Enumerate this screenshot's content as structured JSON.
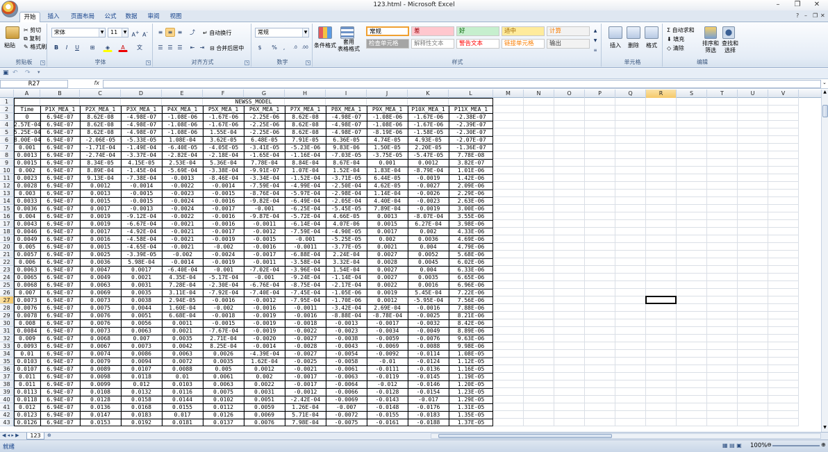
{
  "window": {
    "title": "123.html - Microsoft Excel"
  },
  "ribbon_tabs": [
    "开始",
    "插入",
    "页面布局",
    "公式",
    "数据",
    "审阅",
    "视图"
  ],
  "clipboard": {
    "paste": "粘贴",
    "cut": "剪切",
    "copy": "复制",
    "format_painter": "格式刷",
    "label": "剪贴板"
  },
  "font": {
    "name": "宋体",
    "size": "11",
    "label": "字体",
    "bold": "B",
    "italic": "I",
    "underline": "U"
  },
  "alignment": {
    "wrap": "自动换行",
    "merge": "合并后居中",
    "label": "对齐方式"
  },
  "number": {
    "format": "常规",
    "percent": "%",
    "comma": ",",
    "label": "数字"
  },
  "styles": {
    "conditional": "条件格式",
    "table_format": "套用\n表格格式",
    "cells": [
      {
        "text": "常规",
        "bg": "#ffffff",
        "fg": "#000000"
      },
      {
        "text": "差",
        "bg": "#ffc7ce",
        "fg": "#9c0006"
      },
      {
        "text": "好",
        "bg": "#c6efce",
        "fg": "#006100"
      },
      {
        "text": "适中",
        "bg": "#ffeb9c",
        "fg": "#9c6500"
      },
      {
        "text": "计算",
        "bg": "#f2f2f2",
        "fg": "#fa7d00"
      },
      {
        "text": "检查单元格",
        "bg": "#a5a5a5",
        "fg": "#ffffff"
      },
      {
        "text": "解释性文本",
        "bg": "#ffffff",
        "fg": "#7f7f7f"
      },
      {
        "text": "警告文本",
        "bg": "#ffffff",
        "fg": "#ff0000"
      },
      {
        "text": "链接单元格",
        "bg": "#ffffff",
        "fg": "#fa7d00"
      },
      {
        "text": "输出",
        "bg": "#f2f2f2",
        "fg": "#3f3f3f"
      }
    ],
    "label": "样式"
  },
  "cells_group": {
    "insert": "插入",
    "delete": "删除",
    "format": "格式",
    "label": "单元格"
  },
  "editing": {
    "autosum": "自动求和",
    "fill": "填充",
    "clear": "清除",
    "sort": "排序和\n筛选",
    "find": "查找和\n选择",
    "label": "编辑"
  },
  "name_box": "R27",
  "formula_fx": "fx",
  "columns": [
    "A",
    "B",
    "C",
    "D",
    "E",
    "F",
    "G",
    "H",
    "I",
    "J",
    "K",
    "L",
    "M",
    "N",
    "O",
    "P",
    "Q",
    "R",
    "S",
    "T",
    "U",
    "V"
  ],
  "selected_column": "R",
  "selected_row": "27",
  "sheet": {
    "title": "NEWSS_MODEL",
    "headers": [
      "Time",
      "P1X_MEA_1",
      "P2X_MEA_1",
      "P3X_MEA_1",
      "P4X_MEA_1",
      "P5X_MEA_1",
      "P6X_MEA_1",
      "P7X_MEA_1",
      "P8X_MEA_1",
      "P9X_MEA_1",
      "P10X_MEA_1",
      "P11X_MEA_1"
    ],
    "rows": [
      [
        "0",
        "6.94E-07",
        "8.62E-08",
        "-4.98E-07",
        "-1.08E-06",
        "-1.67E-06",
        "-2.25E-06",
        "8.62E-08",
        "-4.98E-07",
        "-1.08E-06",
        "-1.67E-06",
        "-2.38E-07"
      ],
      [
        "2.57E-04",
        "6.94E-07",
        "8.62E-08",
        "-4.98E-07",
        "-1.08E-06",
        "-1.67E-06",
        "-2.25E-06",
        "8.62E-08",
        "-4.98E-07",
        "-1.08E-06",
        "-1.67E-06",
        "-2.39E-07"
      ],
      [
        "5.25E-04",
        "6.94E-07",
        "8.62E-08",
        "-4.98E-07",
        "-1.08E-06",
        "1.55E-04",
        "-2.25E-06",
        "8.62E-08",
        "-4.98E-07",
        "-8.19E-06",
        "-1.58E-05",
        "-2.30E-07"
      ],
      [
        "8.00E-04",
        "6.94E-07",
        "-2.06E-05",
        "-5.33E-05",
        "1.08E-04",
        "3.62E-05",
        "6.48E-05",
        "7.91E-05",
        "6.36E-05",
        "4.74E-05",
        "4.93E-05",
        "-2.07E-07"
      ],
      [
        "0.001",
        "6.94E-07",
        "-1.71E-04",
        "-1.49E-04",
        "-6.40E-05",
        "-4.05E-05",
        "-3.41E-05",
        "-5.23E-06",
        "9.83E-06",
        "1.50E-05",
        "2.20E-05",
        "-1.36E-07"
      ],
      [
        "0.0013",
        "6.94E-07",
        "-2.74E-04",
        "-3.37E-04",
        "-2.82E-04",
        "-2.18E-04",
        "-1.65E-04",
        "-1.16E-04",
        "-7.03E-05",
        "-3.75E-05",
        "-5.47E-05",
        "7.78E-08"
      ],
      [
        "0.0015",
        "6.94E-07",
        "8.34E-05",
        "4.15E-05",
        "2.53E-04",
        "5.36E-04",
        "7.78E-04",
        "8.84E-04",
        "8.67E-04",
        "0.001",
        "0.0012",
        "3.82E-07"
      ],
      [
        "0.002",
        "6.94E-07",
        "8.89E-04",
        "-1.45E-04",
        "-5.69E-04",
        "-3.38E-04",
        "-9.91E-07",
        "1.07E-04",
        "1.52E-04",
        "1.83E-04",
        "-8.79E-04",
        "1.01E-06"
      ],
      [
        "0.0023",
        "6.94E-07",
        "9.13E-04",
        "-7.38E-04",
        "-0.0013",
        "-8.46E-04",
        "-3.34E-04",
        "-1.52E-04",
        "-3.71E-05",
        "6.44E-05",
        "-0.0019",
        "1.42E-06"
      ],
      [
        "0.0028",
        "6.94E-07",
        "0.0012",
        "-0.0014",
        "-0.0022",
        "-0.0014",
        "-7.59E-04",
        "-4.99E-04",
        "-2.50E-04",
        "4.62E-05",
        "-0.0027",
        "2.09E-06"
      ],
      [
        "0.003",
        "6.94E-07",
        "0.0013",
        "-0.0015",
        "-0.0023",
        "-0.0015",
        "-8.76E-04",
        "-5.97E-04",
        "-2.98E-04",
        "1.14E-04",
        "-0.0026",
        "2.29E-06"
      ],
      [
        "0.0033",
        "6.94E-07",
        "0.0015",
        "-0.0015",
        "-0.0024",
        "-0.0016",
        "-9.82E-04",
        "-6.49E-04",
        "-2.05E-04",
        "4.40E-04",
        "-0.0023",
        "2.63E-06"
      ],
      [
        "0.0036",
        "6.94E-07",
        "0.0017",
        "-0.0013",
        "-0.0024",
        "-0.0017",
        "-0.001",
        "-6.25E-04",
        "-5.45E-05",
        "7.89E-04",
        "-0.0019",
        "3.00E-06"
      ],
      [
        "0.004",
        "6.94E-07",
        "0.0019",
        "-9.12E-04",
        "-0.0022",
        "-0.0016",
        "-9.87E-04",
        "-5.72E-04",
        "4.66E-05",
        "0.0013",
        "-8.07E-04",
        "3.55E-06"
      ],
      [
        "0.0043",
        "6.94E-07",
        "0.0019",
        "-6.67E-04",
        "-0.0021",
        "-0.0016",
        "-0.0011",
        "-6.14E-04",
        "4.07E-06",
        "0.0015",
        "6.27E-04",
        "3.98E-06"
      ],
      [
        "0.0046",
        "6.94E-07",
        "0.0017",
        "-4.92E-04",
        "-0.0021",
        "-0.0017",
        "-0.0012",
        "-7.59E-04",
        "-4.90E-05",
        "0.0017",
        "0.002",
        "4.33E-06"
      ],
      [
        "0.0049",
        "6.94E-07",
        "0.0016",
        "-4.58E-04",
        "-0.0021",
        "-0.0019",
        "-0.0015",
        "-0.001",
        "-5.25E-05",
        "0.002",
        "0.0036",
        "4.69E-06"
      ],
      [
        "0.005",
        "6.94E-07",
        "0.0015",
        "-4.65E-04",
        "-0.0021",
        "-0.002",
        "-0.0016",
        "-0.0011",
        "-3.77E-05",
        "0.0021",
        "0.004",
        "4.79E-06"
      ],
      [
        "0.0057",
        "6.94E-07",
        "0.0025",
        "-3.39E-05",
        "-0.002",
        "-0.0024",
        "-0.0017",
        "-6.88E-04",
        "2.24E-04",
        "0.0027",
        "0.0052",
        "5.68E-06"
      ],
      [
        "0.006",
        "6.94E-07",
        "0.0036",
        "5.98E-04",
        "-0.0014",
        "-0.0019",
        "-0.0011",
        "-3.58E-04",
        "3.32E-04",
        "0.0028",
        "0.0045",
        "6.02E-06"
      ],
      [
        "0.0063",
        "6.94E-07",
        "0.0047",
        "0.0017",
        "-6.40E-04",
        "-0.001",
        "-7.02E-04",
        "-3.96E-04",
        "1.54E-04",
        "0.0027",
        "0.004",
        "6.33E-06"
      ],
      [
        "0.0065",
        "6.94E-07",
        "0.0049",
        "0.0021",
        "4.35E-04",
        "-5.17E-04",
        "-0.001",
        "-9.24E-04",
        "-1.14E-04",
        "0.0027",
        "0.0035",
        "6.65E-06"
      ],
      [
        "0.0068",
        "6.94E-07",
        "0.0063",
        "0.0031",
        "7.28E-04",
        "-2.30E-04",
        "-6.76E-04",
        "-8.75E-04",
        "-2.17E-04",
        "0.0022",
        "0.0016",
        "6.96E-06"
      ],
      [
        "0.007",
        "6.94E-07",
        "0.0069",
        "0.0035",
        "3.11E-04",
        "-7.92E-04",
        "-7.40E-04",
        "-7.45E-04",
        "-1.05E-06",
        "0.0019",
        "5.45E-04",
        "7.22E-06"
      ],
      [
        "0.0073",
        "6.94E-07",
        "0.0073",
        "0.0038",
        "2.94E-05",
        "-0.0016",
        "-0.0012",
        "-7.95E-04",
        "-1.70E-06",
        "0.0012",
        "-5.95E-04",
        "7.56E-06"
      ],
      [
        "0.0076",
        "6.94E-07",
        "0.0075",
        "0.0044",
        "1.60E-04",
        "-0.002",
        "-0.0016",
        "-0.0011",
        "-3.42E-04",
        "2.69E-04",
        "-0.0016",
        "7.88E-06"
      ],
      [
        "0.0078",
        "6.94E-07",
        "0.0076",
        "0.0051",
        "6.68E-04",
        "-0.0018",
        "-0.0019",
        "-0.0016",
        "-8.88E-04",
        "-8.78E-04",
        "-0.0025",
        "8.21E-06"
      ],
      [
        "0.008",
        "6.94E-07",
        "0.0076",
        "0.0056",
        "0.0011",
        "-0.0015",
        "-0.0019",
        "-0.0018",
        "-0.0013",
        "-0.0017",
        "-0.0032",
        "8.42E-06"
      ],
      [
        "0.0084",
        "6.94E-07",
        "0.0073",
        "0.0063",
        "0.0021",
        "-7.67E-04",
        "-0.0019",
        "-0.0022",
        "-0.0023",
        "-0.0034",
        "-0.0049",
        "8.89E-06"
      ],
      [
        "0.009",
        "6.94E-07",
        "0.0068",
        "0.007",
        "0.0035",
        "2.71E-04",
        "-0.0020",
        "-0.0027",
        "-0.0038",
        "-0.0059",
        "-0.0076",
        "9.63E-06"
      ],
      [
        "0.0093",
        "6.94E-07",
        "0.0067",
        "0.0073",
        "0.0042",
        "8.25E-04",
        "-0.0014",
        "-0.0028",
        "-0.0043",
        "-0.0069",
        "-0.0088",
        "9.98E-06"
      ],
      [
        "0.01",
        "6.94E-07",
        "0.0074",
        "0.0086",
        "0.0063",
        "0.0026",
        "-4.39E-04",
        "-0.0027",
        "-0.0054",
        "-0.0092",
        "-0.0114",
        "1.08E-05"
      ],
      [
        "0.0103",
        "6.94E-07",
        "0.0079",
        "0.0094",
        "0.0072",
        "0.0035",
        "1.62E-04",
        "-0.0025",
        "-0.0058",
        "-0.01",
        "-0.0124",
        "1.12E-05"
      ],
      [
        "0.0107",
        "6.94E-07",
        "0.0089",
        "0.0107",
        "0.0088",
        "0.005",
        "0.0012",
        "-0.0021",
        "-0.0061",
        "-0.0111",
        "-0.0136",
        "1.16E-05"
      ],
      [
        "0.011",
        "6.94E-07",
        "0.0098",
        "0.0118",
        "0.01",
        "0.0061",
        "0.002",
        "-0.0017",
        "-0.0063",
        "-0.0119",
        "-0.0145",
        "1.19E-05"
      ],
      [
        "0.011",
        "6.94E-07",
        "0.0099",
        "0.012",
        "0.0103",
        "0.0063",
        "0.0022",
        "-0.0017",
        "-0.0064",
        "-0.012",
        "-0.0146",
        "1.20E-05"
      ],
      [
        "0.0113",
        "6.94E-07",
        "0.0108",
        "0.0132",
        "0.0116",
        "0.0075",
        "0.0031",
        "-0.0012",
        "-0.0066",
        "-0.0128",
        "-0.0154",
        "1.23E-05"
      ],
      [
        "0.0118",
        "6.94E-07",
        "0.0128",
        "0.0158",
        "0.0144",
        "0.0102",
        "0.0051",
        "-2.42E-04",
        "-0.0069",
        "-0.0143",
        "-0.017",
        "1.29E-05"
      ],
      [
        "0.012",
        "6.94E-07",
        "0.0136",
        "0.0168",
        "0.0155",
        "0.0112",
        "0.0059",
        "1.26E-04",
        "-0.007",
        "-0.0148",
        "-0.0176",
        "1.31E-05"
      ],
      [
        "0.0123",
        "6.94E-07",
        "0.0147",
        "0.0183",
        "0.017",
        "0.0126",
        "0.0069",
        "5.71E-04",
        "-0.0072",
        "-0.0155",
        "-0.0183",
        "1.35E-05"
      ],
      [
        "0.0126",
        "6.94E-07",
        "0.0153",
        "0.0192",
        "0.0181",
        "0.0137",
        "0.0076",
        "7.98E-04",
        "-0.0075",
        "-0.0161",
        "-0.0188",
        "1.37E-05"
      ]
    ]
  },
  "sheet_tab": "123",
  "status": "就绪",
  "zoom": "100%"
}
